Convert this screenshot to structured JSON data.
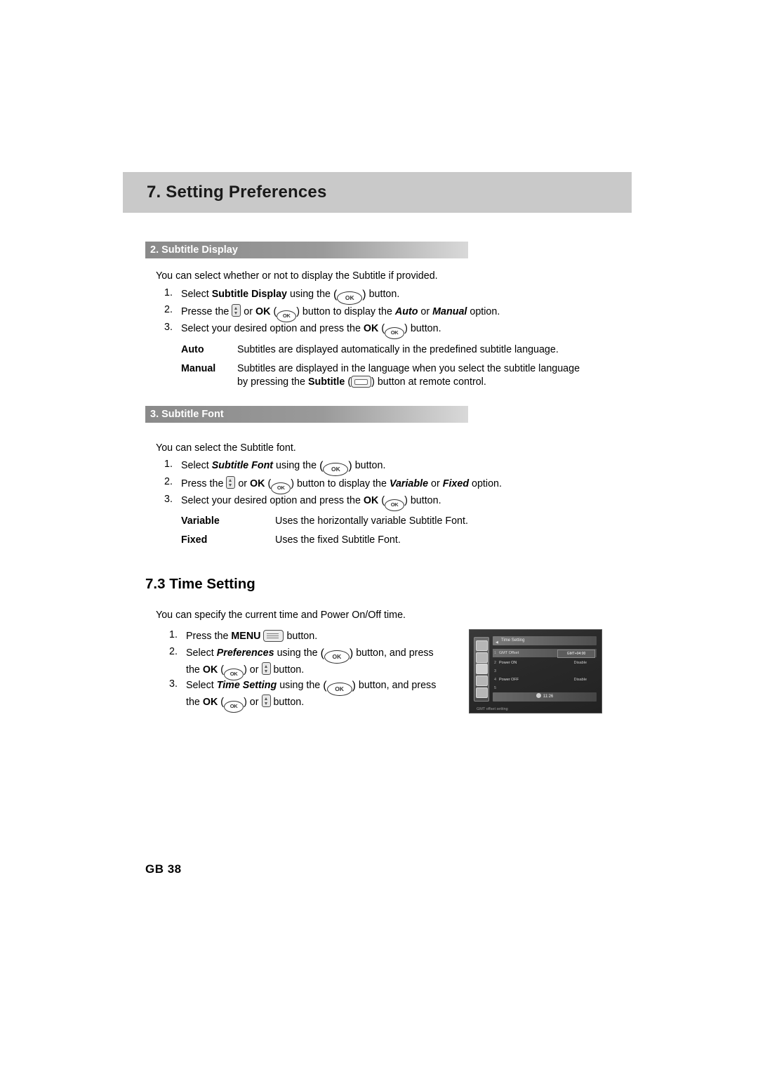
{
  "chapter": {
    "title": "7. Setting Preferences"
  },
  "sections": [
    {
      "heading": "2. Subtitle Display",
      "intro": "You can select whether or not to display the Subtitle if provided.",
      "steps": [
        {
          "num": "1.",
          "parts": [
            {
              "t": "Select ",
              "style": "plain"
            },
            {
              "t": "Subtitle Display",
              "style": "bold"
            },
            {
              "t": " using the ",
              "style": "plain"
            },
            {
              "t": "(OK-LARGE)",
              "style": "key"
            },
            {
              "t": " button.",
              "style": "plain"
            }
          ]
        },
        {
          "num": "2.",
          "parts": [
            {
              "t": "Presse the ",
              "style": "plain"
            },
            {
              "t": "(UPDOWN)",
              "style": "key"
            },
            {
              "t": " or ",
              "style": "plain"
            },
            {
              "t": "OK",
              "style": "bold"
            },
            {
              "t": " (OK) button to display the ",
              "style": "plain"
            },
            {
              "t": "Auto",
              "style": "bolditalic"
            },
            {
              "t": " or ",
              "style": "plain"
            },
            {
              "t": "Manual",
              "style": "bolditalic"
            },
            {
              "t": " option.",
              "style": "plain"
            }
          ]
        },
        {
          "num": "3.",
          "parts": [
            {
              "t": "Select your desired option and press the ",
              "style": "plain"
            },
            {
              "t": "OK",
              "style": "bold"
            },
            {
              "t": " (OK) button.",
              "style": "plain"
            }
          ]
        }
      ],
      "defs": [
        {
          "term": "Auto",
          "lines": [
            "Subtitles are displayed automatically in the predefined subtitle language."
          ]
        },
        {
          "term": "Manual",
          "lines": [
            "Subtitles are displayed in the language when you select the subtitle language",
            "by pressing the Subtitle ( ) button at remote control."
          ]
        }
      ]
    },
    {
      "heading": "3. Subtitle Font",
      "intro": "You can select the Subtitle font.",
      "steps": [
        {
          "num": "1.",
          "parts": [
            {
              "t": "Select ",
              "style": "plain"
            },
            {
              "t": "Subtitle Font",
              "style": "bolditalic"
            },
            {
              "t": " using the ",
              "style": "plain"
            },
            {
              "t": "(OK-LARGE)",
              "style": "key"
            },
            {
              "t": " button.",
              "style": "plain"
            }
          ]
        },
        {
          "num": "2.",
          "parts": [
            {
              "t": "Press the ",
              "style": "plain"
            },
            {
              "t": "(UPDOWN)",
              "style": "key"
            },
            {
              "t": " or ",
              "style": "plain"
            },
            {
              "t": "OK",
              "style": "bold"
            },
            {
              "t": " (OK) button to display the ",
              "style": "plain"
            },
            {
              "t": "Variable",
              "style": "bolditalic"
            },
            {
              "t": " or ",
              "style": "plain"
            },
            {
              "t": "Fixed",
              "style": "bolditalic"
            },
            {
              "t": " option.",
              "style": "plain"
            }
          ]
        },
        {
          "num": "3.",
          "parts": [
            {
              "t": "Select your desired option and press the ",
              "style": "plain"
            },
            {
              "t": "OK",
              "style": "bold"
            },
            {
              "t": " (OK) button.",
              "style": "plain"
            }
          ]
        }
      ],
      "defs": [
        {
          "term": "Variable",
          "lines": [
            "Uses the horizontally variable Subtitle Font."
          ]
        },
        {
          "term": "Fixed",
          "lines": [
            "Uses the fixed Subtitle Font."
          ]
        }
      ]
    }
  ],
  "time_setting": {
    "heading": "7.3 Time Setting",
    "intro": "You can specify the current time and Power On/Off time.",
    "steps": [
      {
        "num": "1.",
        "text_a": "Press the ",
        "bold": "MENU",
        "text_b": " button."
      },
      {
        "num": "2.",
        "line1_a": "Select ",
        "line1_bold": "Preferences",
        "line1_b": " using the ",
        "line1_c": " button, and press",
        "line2_a": "the ",
        "line2_bold": "OK",
        "line2_b": " or ",
        "line2_c": " button."
      },
      {
        "num": "3.",
        "line1_a": "Select ",
        "line1_bold": "Time Setting",
        "line1_b": " using the ",
        "line1_c": " button, and press",
        "line2_a": "the ",
        "line2_bold": "OK",
        "line2_b": " or ",
        "line2_c": " button."
      }
    ]
  },
  "osd": {
    "title": "Time Setting",
    "rows": [
      {
        "num": "1",
        "label": "GMT Offset",
        "value": "GMT+04:00",
        "highlight": true,
        "boxed": true
      },
      {
        "num": "2",
        "label": "Power ON",
        "value": "Disable",
        "highlight": false,
        "boxed": false
      },
      {
        "num": "3",
        "label": "",
        "value": "",
        "highlight": false,
        "boxed": false
      },
      {
        "num": "4",
        "label": "Power OFF",
        "value": "Disable",
        "highlight": false,
        "boxed": false
      },
      {
        "num": "5",
        "label": "",
        "value": "",
        "highlight": false,
        "boxed": false
      }
    ],
    "clock": "11:26",
    "footer": "GMT offset setting"
  },
  "footer": {
    "page": "GB 38"
  },
  "colors": {
    "chapter_bar": "#c9c9c9",
    "section_bar": "#8a8a8a",
    "text": "#000000"
  }
}
